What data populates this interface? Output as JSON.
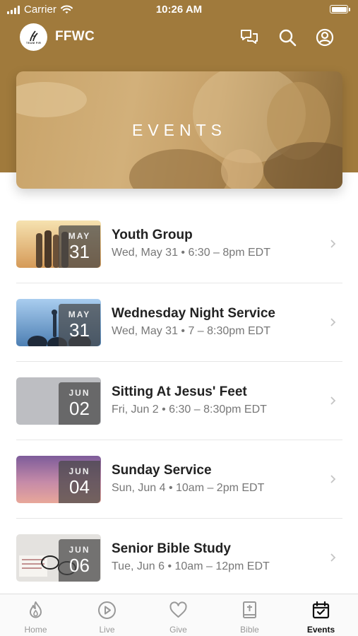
{
  "status_bar": {
    "carrier": "Carrier",
    "time": "10:26 AM"
  },
  "header": {
    "logo_text": "TEAM FIR",
    "title": "FFWC"
  },
  "hero": {
    "title": "EVENTS"
  },
  "events": [
    {
      "title": "Youth Group",
      "subtitle": "Wed, May 31 • 6:30 – 8pm EDT",
      "month": "MAY",
      "day": "31"
    },
    {
      "title": "Wednesday Night Service",
      "subtitle": "Wed, May 31 • 7 – 8:30pm EDT",
      "month": "MAY",
      "day": "31"
    },
    {
      "title": "Sitting At Jesus' Feet",
      "subtitle": "Fri, Jun 2 • 6:30 – 8:30pm EDT",
      "month": "JUN",
      "day": "02"
    },
    {
      "title": "Sunday Service",
      "subtitle": "Sun, Jun 4 • 10am – 2pm EDT",
      "month": "JUN",
      "day": "04"
    },
    {
      "title": "Senior Bible Study",
      "subtitle": "Tue, Jun 6 • 10am – 12pm EDT",
      "month": "JUN",
      "day": "06"
    }
  ],
  "tabs": [
    {
      "label": "Home",
      "icon": "flame-icon"
    },
    {
      "label": "Live",
      "icon": "play-icon"
    },
    {
      "label": "Give",
      "icon": "heart-icon"
    },
    {
      "label": "Bible",
      "icon": "bible-icon"
    },
    {
      "label": "Events",
      "icon": "calendar-icon",
      "active": true
    }
  ],
  "colors": {
    "brand": "#a07a3c",
    "active_tab": "#111111",
    "inactive_tab": "#999999"
  }
}
